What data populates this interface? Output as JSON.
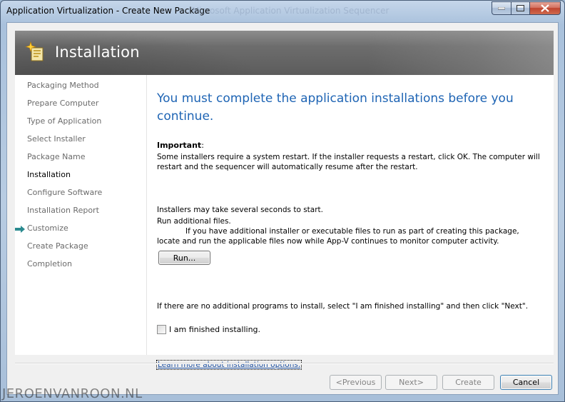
{
  "window": {
    "title": "Application Virtualization - Create New Package",
    "ghost_title": "Microsoft Application Virtualization Sequencer"
  },
  "header": {
    "title": "Installation",
    "icon": "installer-sparkle-icon"
  },
  "nav": {
    "items": [
      {
        "label": "Packaging Method",
        "current": false
      },
      {
        "label": "Prepare Computer",
        "current": false
      },
      {
        "label": "Type of Application",
        "current": false
      },
      {
        "label": "Select Installer",
        "current": false
      },
      {
        "label": "Package Name",
        "current": false
      },
      {
        "label": "Installation",
        "current": true
      },
      {
        "label": "Configure Software",
        "current": false
      },
      {
        "label": "Installation Report",
        "current": false
      },
      {
        "label": "Customize",
        "current": false
      },
      {
        "label": "Create Package",
        "current": false
      },
      {
        "label": "Completion",
        "current": false
      }
    ]
  },
  "main": {
    "heading": "You must complete the application installations before you continue.",
    "important_title": "Important",
    "important_colon": ":",
    "important_text": "Some installers require a system restart. If the installer requests a restart, click OK. The computer will restart and the sequencer will automatically resume after the restart.",
    "installers_note": "Installers may take several seconds to start.",
    "run_additional": "Run additional files.",
    "run_additional_desc": "If you have additional installer or executable files to run as part of creating this package, locate and run the applicable files now while App-V continues to monitor computer activity.",
    "run_button": "Run...",
    "finish_hint": "If there are no additional programs to install, select \"I am finished installing\" and then click \"Next\".",
    "checkbox_label": "I am finished installing.",
    "checkbox_checked": false,
    "learn_more": "Learn more about installation options."
  },
  "footer": {
    "previous": "<Previous",
    "next": "Next>",
    "create": "Create",
    "cancel": "Cancel"
  },
  "watermark": "JEROENVANROON.NL",
  "colors": {
    "heading": "#1e64b4",
    "link": "#1e50a0",
    "nav_arrow": "#2a8a8f"
  }
}
